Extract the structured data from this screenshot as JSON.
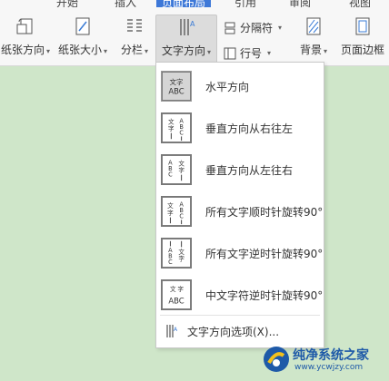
{
  "menu_tabs": [
    "开始",
    "插入",
    "页面布局",
    "引用",
    "审阅",
    "视图"
  ],
  "ribbon": {
    "orientation_label": "纸张方向",
    "paper_size_label": "纸张大小",
    "columns_label": "分栏",
    "text_direction_label": "文字方向",
    "separator_label": "分隔符",
    "line_number_label": "行号",
    "background_label": "背景",
    "page_border_label": "页面边框"
  },
  "dropdown": {
    "items": [
      {
        "label": "水平方向",
        "icon": "horizontal-text-icon"
      },
      {
        "label": "垂直方向从右往左",
        "icon": "vertical-rtl-icon"
      },
      {
        "label": "垂直方向从左往右",
        "icon": "vertical-ltr-icon"
      },
      {
        "label": "所有文字顺时针旋转90°",
        "icon": "rotate-cw-icon"
      },
      {
        "label": "所有文字逆时针旋转90°",
        "icon": "rotate-ccw-icon"
      },
      {
        "label": "中文字符逆时针旋转90°",
        "icon": "cjk-rotate-ccw-icon"
      }
    ],
    "options_label": "文字方向选项(X)..."
  },
  "watermark": {
    "title": "纯净系统之家",
    "url": "www.ycwjzy.com"
  }
}
